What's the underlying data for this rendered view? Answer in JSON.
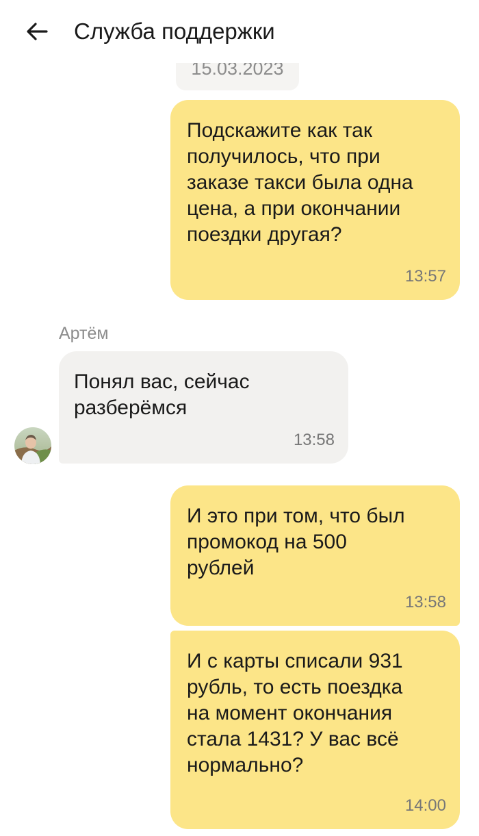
{
  "header": {
    "back_icon": "arrow-left-icon",
    "title": "Служба поддержки"
  },
  "chat": {
    "date": "15.03.2023",
    "messages": [
      {
        "direction": "outgoing",
        "text": "Подскажите как так\nполучилось, что при\nзаказе такси была одна\nцена, а при окончании\nпоездки другая?",
        "time": "13:57"
      },
      {
        "direction": "incoming",
        "sender": "Артём",
        "text": "Понял вас, сейчас\nразберёмся",
        "time": "13:58",
        "avatar_icon": "user-avatar"
      },
      {
        "direction": "outgoing",
        "text": "И это при том, что был\nпромокод на 500\nрублей",
        "time": "13:58"
      },
      {
        "direction": "outgoing",
        "text": "И с карты списали 931\nрубль, то есть поездка\nна момент окончания\nстала 1431? У вас всё\nнормально?",
        "time": "14:00"
      }
    ]
  },
  "colors": {
    "outgoing_bubble": "#fce588",
    "incoming_bubble": "#f2f1ef",
    "date_chip": "#f5f4f2",
    "muted_text": "#8c8c8c"
  }
}
